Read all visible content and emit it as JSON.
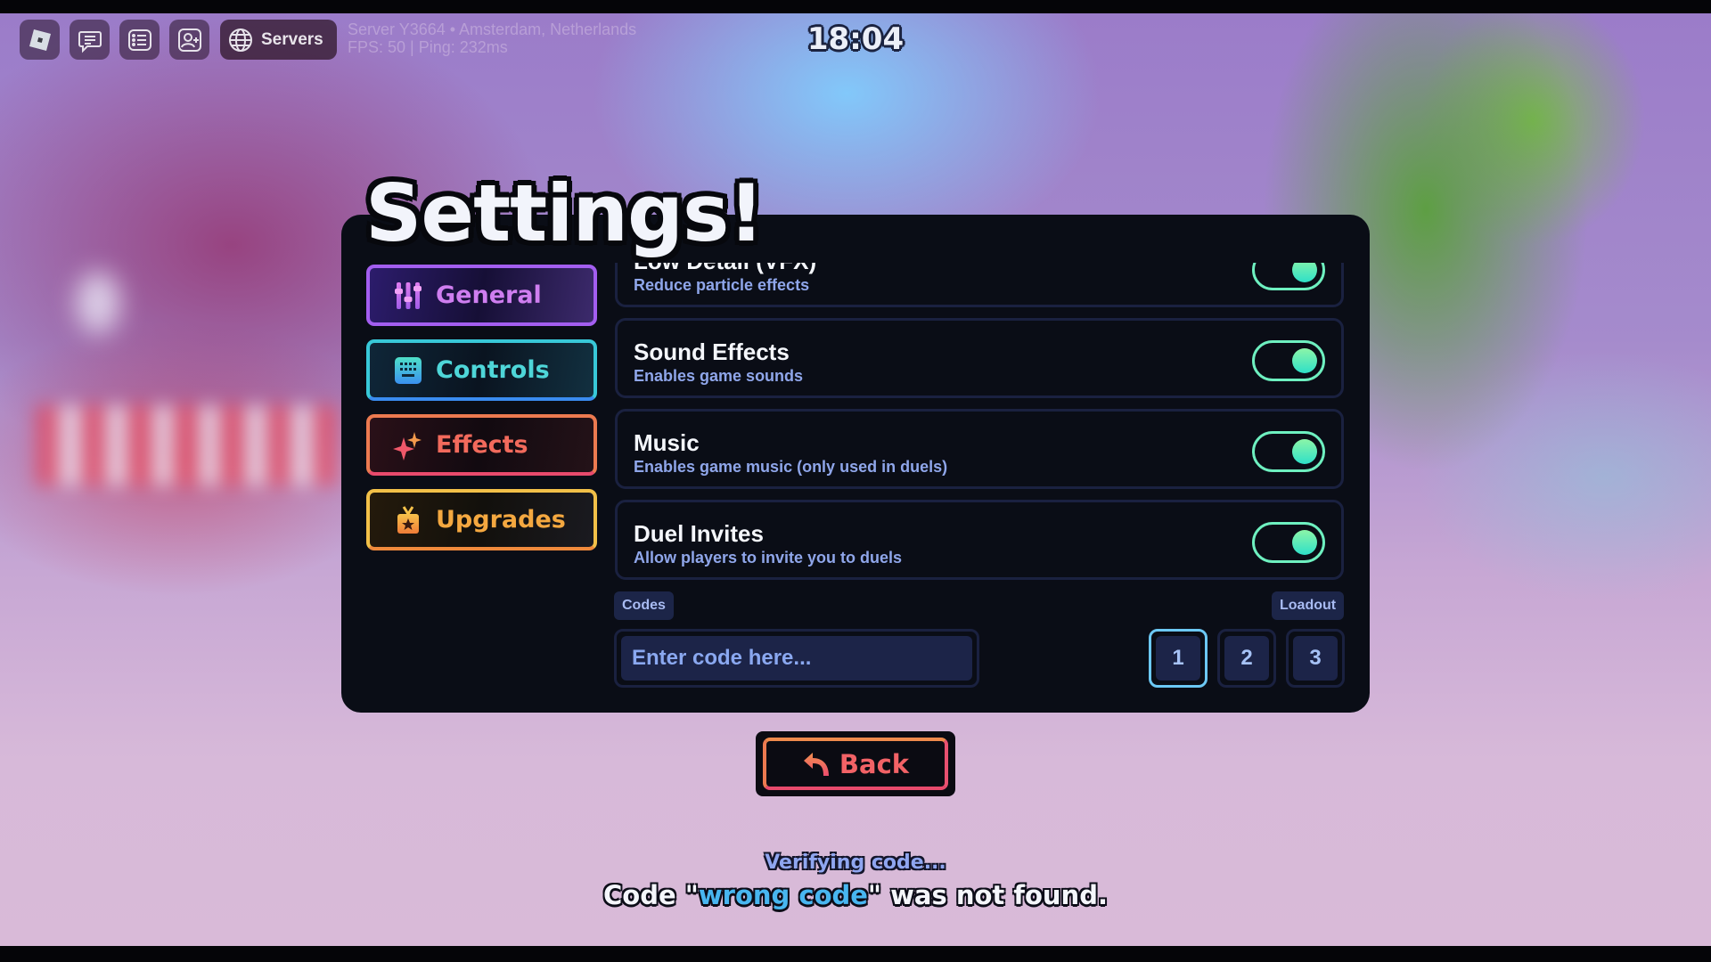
{
  "hud": {
    "buttons": [
      {
        "name": "roblox-menu",
        "icon": "roblox-logo-icon"
      },
      {
        "name": "chat",
        "icon": "chat-icon"
      },
      {
        "name": "player-list",
        "icon": "list-icon"
      },
      {
        "name": "add-friend",
        "icon": "add-friend-icon"
      }
    ],
    "servers_label": "Servers",
    "server_info_line1": "Server Y3664 • Amsterdam, Netherlands",
    "server_info_line2": "FPS: 50 | Ping: 232ms",
    "clock": "18:04"
  },
  "settings": {
    "title": "Settings!",
    "nav": [
      {
        "label": "General",
        "icon": "sliders-icon",
        "color": "#cf7ef0"
      },
      {
        "label": "Controls",
        "icon": "keyboard-icon",
        "color": "#4ed6d8"
      },
      {
        "label": "Effects",
        "icon": "sparkle-icon",
        "color": "#f26a5c"
      },
      {
        "label": "Upgrades",
        "icon": "gift-box-icon",
        "color": "#f4a840"
      }
    ],
    "options": [
      {
        "title": "Low Detail (VFX)",
        "description": "Reduce particle effects",
        "enabled": true
      },
      {
        "title": "Sound Effects",
        "description": "Enables game sounds",
        "enabled": true
      },
      {
        "title": "Music",
        "description": "Enables game music (only used in duels)",
        "enabled": true
      },
      {
        "title": "Duel Invites",
        "description": "Allow players to invite you to duels",
        "enabled": true
      }
    ],
    "codes_label": "Codes",
    "code_input_value": "",
    "code_input_placeholder": "Enter code here...",
    "loadout_label": "Loadout",
    "loadout_slots": [
      "1",
      "2",
      "3"
    ],
    "loadout_selected": "1",
    "toggle_color": "#6ef0c0"
  },
  "back_button": {
    "label": "Back",
    "icon": "back-arrow-icon"
  },
  "messages": {
    "verifying": "Verifying code...",
    "result_prefix": "Code \"",
    "result_code": "wrong code",
    "result_suffix": "\" was not found."
  }
}
